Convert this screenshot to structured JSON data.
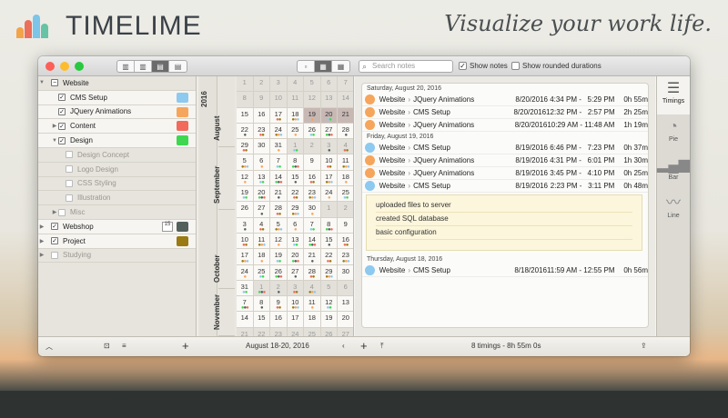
{
  "brand": {
    "name": "TIMELIME",
    "tagline": "Visualize your work life."
  },
  "toolbar": {
    "search_placeholder": "Search notes",
    "show_notes_label": "Show notes",
    "show_notes_checked": true,
    "show_rounded_label": "Show rounded durations",
    "show_rounded_checked": false
  },
  "sidebar": {
    "items": [
      {
        "label": "Website",
        "expanded": true,
        "checked": "partial",
        "level": 0
      },
      {
        "label": "CMS Setup",
        "checked": true,
        "level": 1,
        "color": "#8ec9ef"
      },
      {
        "label": "JQuery Animations",
        "checked": true,
        "level": 1,
        "color": "#f6a55c"
      },
      {
        "label": "Content",
        "checked": true,
        "level": 1,
        "collapsed": true,
        "color": "#f26a5b"
      },
      {
        "label": "Design",
        "checked": true,
        "level": 1,
        "expanded": true,
        "color": "#3fd74f"
      },
      {
        "label": "Design Concept",
        "checked": false,
        "level": 2
      },
      {
        "label": "Logo Design",
        "checked": false,
        "level": 2
      },
      {
        "label": "CSS Styling",
        "checked": false,
        "level": 2
      },
      {
        "label": "Illustration",
        "checked": false,
        "level": 2
      },
      {
        "label": "Misc",
        "checked": false,
        "level": 1,
        "collapsed": true
      },
      {
        "label": "Webshop",
        "checked": true,
        "level": 0,
        "collapsed": true,
        "color": "#535f5b",
        "badge": "15"
      },
      {
        "label": "Project",
        "checked": true,
        "level": 0,
        "collapsed": true,
        "color": "#9a7a12"
      },
      {
        "label": "Studying",
        "checked": false,
        "level": 0
      }
    ]
  },
  "calendar": {
    "year": "2016",
    "months": [
      "August",
      "September",
      "October",
      "November"
    ],
    "rows": [
      [
        "1",
        "2",
        "3",
        "4",
        "5",
        "6",
        "7"
      ],
      [
        "8",
        "9",
        "10",
        "11",
        "12",
        "13",
        "14"
      ],
      [
        "15",
        "16",
        "17",
        "18",
        "19",
        "20",
        "21"
      ],
      [
        "22",
        "23",
        "24",
        "25",
        "26",
        "27",
        "28"
      ],
      [
        "29",
        "30",
        "31",
        "1",
        "2",
        "3",
        "4"
      ],
      [
        "5",
        "6",
        "7",
        "8",
        "9",
        "10",
        "11"
      ],
      [
        "12",
        "13",
        "14",
        "15",
        "16",
        "17",
        "18"
      ],
      [
        "19",
        "20",
        "21",
        "22",
        "23",
        "24",
        "25"
      ],
      [
        "26",
        "27",
        "28",
        "29",
        "30",
        "1",
        "2"
      ],
      [
        "3",
        "4",
        "5",
        "6",
        "7",
        "8",
        "9"
      ],
      [
        "10",
        "11",
        "12",
        "13",
        "14",
        "15",
        "16"
      ],
      [
        "17",
        "18",
        "19",
        "20",
        "21",
        "22",
        "23"
      ],
      [
        "24",
        "25",
        "26",
        "27",
        "28",
        "29",
        "30"
      ],
      [
        "31",
        "1",
        "2",
        "3",
        "4",
        "5",
        "6"
      ],
      [
        "7",
        "8",
        "9",
        "10",
        "11",
        "12",
        "13"
      ],
      [
        "14",
        "15",
        "16",
        "17",
        "18",
        "19",
        "20"
      ],
      [
        "21",
        "22",
        "23",
        "24",
        "25",
        "26",
        "27"
      ],
      [
        "28",
        "29",
        "30",
        "1",
        "2",
        "3",
        "4"
      ]
    ],
    "selection_label": "August 18-20, 2016"
  },
  "timings": {
    "days": [
      {
        "header": "Saturday, August 20, 2016",
        "entries": [
          {
            "color": "#f6a55c",
            "project": "Website",
            "task": "JQuery Animations",
            "date": "8/20/2016",
            "range": "4:34 PM -   5:29 PM",
            "duration": "0h 55m"
          },
          {
            "color": "#f6a55c",
            "project": "Website",
            "task": "CMS Setup",
            "date": "8/20/2016",
            "range": "12:32 PM -   2:57 PM",
            "duration": "2h 25m"
          },
          {
            "color": "#f6a55c",
            "project": "Website",
            "task": "JQuery Animations",
            "date": "8/20/2016",
            "range": "10:29 AM - 11:48 AM",
            "duration": "1h 19m"
          }
        ]
      },
      {
        "header": "Friday, August 19, 2016",
        "entries": [
          {
            "color": "#8ec9ef",
            "project": "Website",
            "task": "CMS Setup",
            "date": "8/19/2016",
            "range": "6:46 PM -   7:23 PM",
            "duration": "0h 37m"
          },
          {
            "color": "#f6a55c",
            "project": "Website",
            "task": "JQuery Animations",
            "date": "8/19/2016",
            "range": "4:31 PM -   6:01 PM",
            "duration": "1h 30m"
          },
          {
            "color": "#f6a55c",
            "project": "Website",
            "task": "JQuery Animations",
            "date": "8/19/2016",
            "range": "3:45 PM -   4:10 PM",
            "duration": "0h 25m"
          },
          {
            "color": "#8ec9ef",
            "project": "Website",
            "task": "CMS Setup",
            "date": "8/19/2016",
            "range": "2:23 PM -   3:11 PM",
            "duration": "0h 48m"
          }
        ],
        "notes": [
          "uploaded files to server",
          "created SQL database",
          "basic configuration"
        ]
      },
      {
        "header": "Thursday, August 18, 2016",
        "entries": [
          {
            "color": "#8ec9ef",
            "project": "Website",
            "task": "CMS Setup",
            "date": "8/18/2016",
            "range": "11:59 AM - 12:55 PM",
            "duration": "0h 56m"
          }
        ]
      }
    ],
    "summary": "8 timings - 8h 55m 0s"
  },
  "views": [
    {
      "label": "Timings",
      "icon": "list-icon",
      "active": true
    },
    {
      "label": "Pie",
      "icon": "pie-chart-icon",
      "active": false
    },
    {
      "label": "Bar",
      "icon": "bar-chart-icon",
      "active": false
    },
    {
      "label": "Line",
      "icon": "line-chart-icon",
      "active": false
    }
  ]
}
